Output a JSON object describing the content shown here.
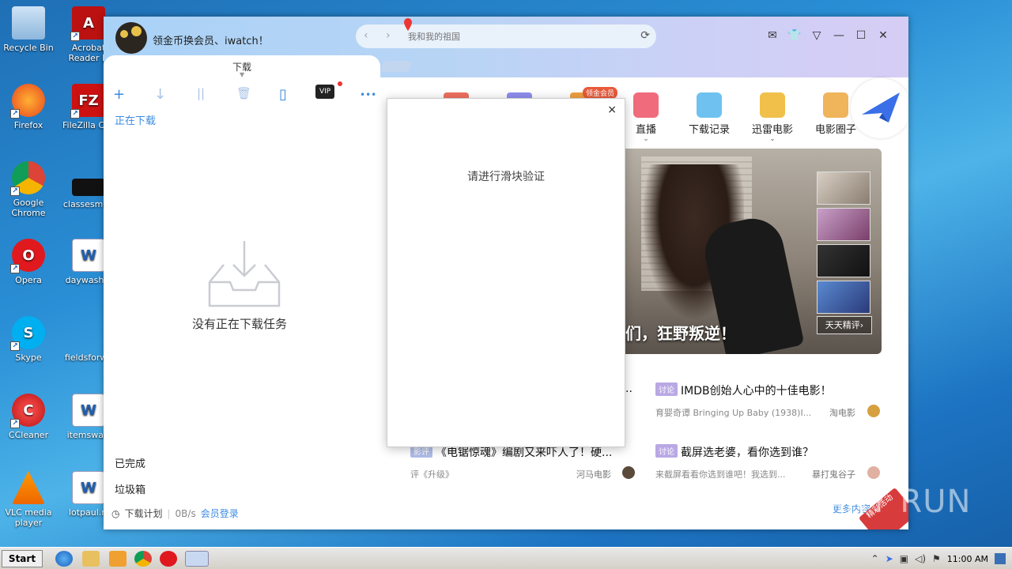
{
  "desktop": {
    "icons": [
      {
        "label": "Recycle Bin"
      },
      {
        "label": "Acrobat Reader D"
      },
      {
        "label": "Firefox"
      },
      {
        "label": "FileZilla Clie"
      },
      {
        "label": "Google Chrome"
      },
      {
        "label": "classesmen"
      },
      {
        "label": "Opera"
      },
      {
        "label": "daywashin"
      },
      {
        "label": "Skype"
      },
      {
        "label": "fieldsforwa"
      },
      {
        "label": "CCleaner"
      },
      {
        "label": "itemsway."
      },
      {
        "label": "VLC media player"
      },
      {
        "label": "lotpaul.rt"
      }
    ]
  },
  "app": {
    "promo_text": "领金币换会员、iwatch！",
    "address_placeholder": "我和我的祖国",
    "nav_back": "‹",
    "nav_forward": "›",
    "window_buttons": [
      "✉",
      "👕",
      "▽",
      "—",
      "☐",
      "✕"
    ],
    "tab_label": "下载",
    "toolbar": {
      "add": "+",
      "download": "↓",
      "pause": "||",
      "delete": "🗑",
      "more": "•••",
      "vip": "VIP"
    },
    "downloading_label": "正在下载",
    "empty_text": "没有正在下载任务",
    "completed_label": "已完成",
    "trash_label": "垃圾箱",
    "status": {
      "plan": "下载计划",
      "speed": "0B/s",
      "login": "会员登录"
    },
    "categories": [
      {
        "label": "直播",
        "color": "#f06b7b",
        "has_chevron": true
      },
      {
        "label": "下载记录",
        "color": "#6fc2f0",
        "has_chevron": false
      },
      {
        "label": "迅雷电影",
        "color": "#f0c04a",
        "has_chevron": true
      },
      {
        "label": "电影圈子",
        "color": "#f0b45a",
        "has_chevron": false
      }
    ],
    "member_badge": "领金会员",
    "banner_caption": "人们，狂野叛逆！",
    "daily_review": "天天精评›",
    "news": [
      {
        "tag": "讨论",
        "title": "IMDB创始人心中的十佳电影！",
        "sub": "育婴奇谭 Bringing Up Baby (1938)I...",
        "source": "淘电影"
      },
      {
        "tag": "影评",
        "title": "《电锯惊魂》编剧又来吓人了！硬...",
        "sub": "评《升级》",
        "source": "河马电影"
      },
      {
        "tag": "讨论",
        "title": "截屏选老婆，看你选到谁？",
        "sub": "来截屏看看你选到谁吧！我选到...",
        "source": "暴打鬼谷子"
      }
    ],
    "more_content": "更多内容›",
    "ribbon_text": "精彩活动"
  },
  "modal": {
    "title": "请进行滑块验证",
    "close": "×"
  },
  "taskbar": {
    "start": "Start",
    "clock": "11:00 AM"
  },
  "watermark": "ANY RUN"
}
